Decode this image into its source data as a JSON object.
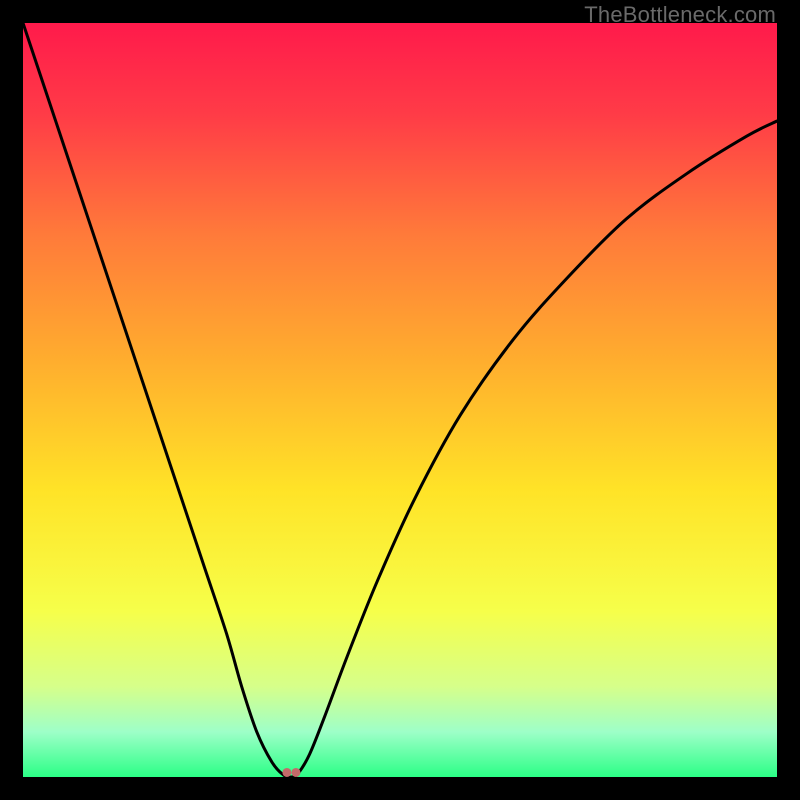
{
  "watermark": "TheBottleneck.com",
  "chart_data": {
    "type": "line",
    "title": "",
    "xlabel": "",
    "ylabel": "",
    "xlim": [
      0,
      100
    ],
    "ylim": [
      0,
      100
    ],
    "background_gradient": {
      "stops": [
        {
          "offset": 0.0,
          "color": "#ff1a4b"
        },
        {
          "offset": 0.12,
          "color": "#ff3b47"
        },
        {
          "offset": 0.28,
          "color": "#ff7a3a"
        },
        {
          "offset": 0.45,
          "color": "#ffae2e"
        },
        {
          "offset": 0.62,
          "color": "#ffe327"
        },
        {
          "offset": 0.78,
          "color": "#f6ff4a"
        },
        {
          "offset": 0.88,
          "color": "#d6ff8a"
        },
        {
          "offset": 0.94,
          "color": "#9effc8"
        },
        {
          "offset": 1.0,
          "color": "#2bff86"
        }
      ]
    },
    "series": [
      {
        "name": "bottleneck-curve",
        "color": "#000000",
        "x": [
          0,
          3,
          6,
          9,
          12,
          15,
          18,
          21,
          24,
          27,
          29,
          31,
          33,
          34.5,
          35.6,
          36.5,
          38,
          40,
          43,
          47,
          52,
          58,
          65,
          72,
          80,
          88,
          96,
          100
        ],
        "values": [
          100,
          91,
          82,
          73,
          64,
          55,
          46,
          37,
          28,
          19,
          12,
          6,
          2,
          0.3,
          0,
          0.5,
          3,
          8,
          16,
          26,
          37,
          48,
          58,
          66,
          74,
          80,
          85,
          87
        ]
      }
    ],
    "markers": [
      {
        "name": "min-marker-1",
        "x": 35.0,
        "y": 0.6,
        "color": "#c46a6a",
        "r": 4.5
      },
      {
        "name": "min-marker-2",
        "x": 36.2,
        "y": 0.6,
        "color": "#c46a6a",
        "r": 4.5
      }
    ]
  }
}
